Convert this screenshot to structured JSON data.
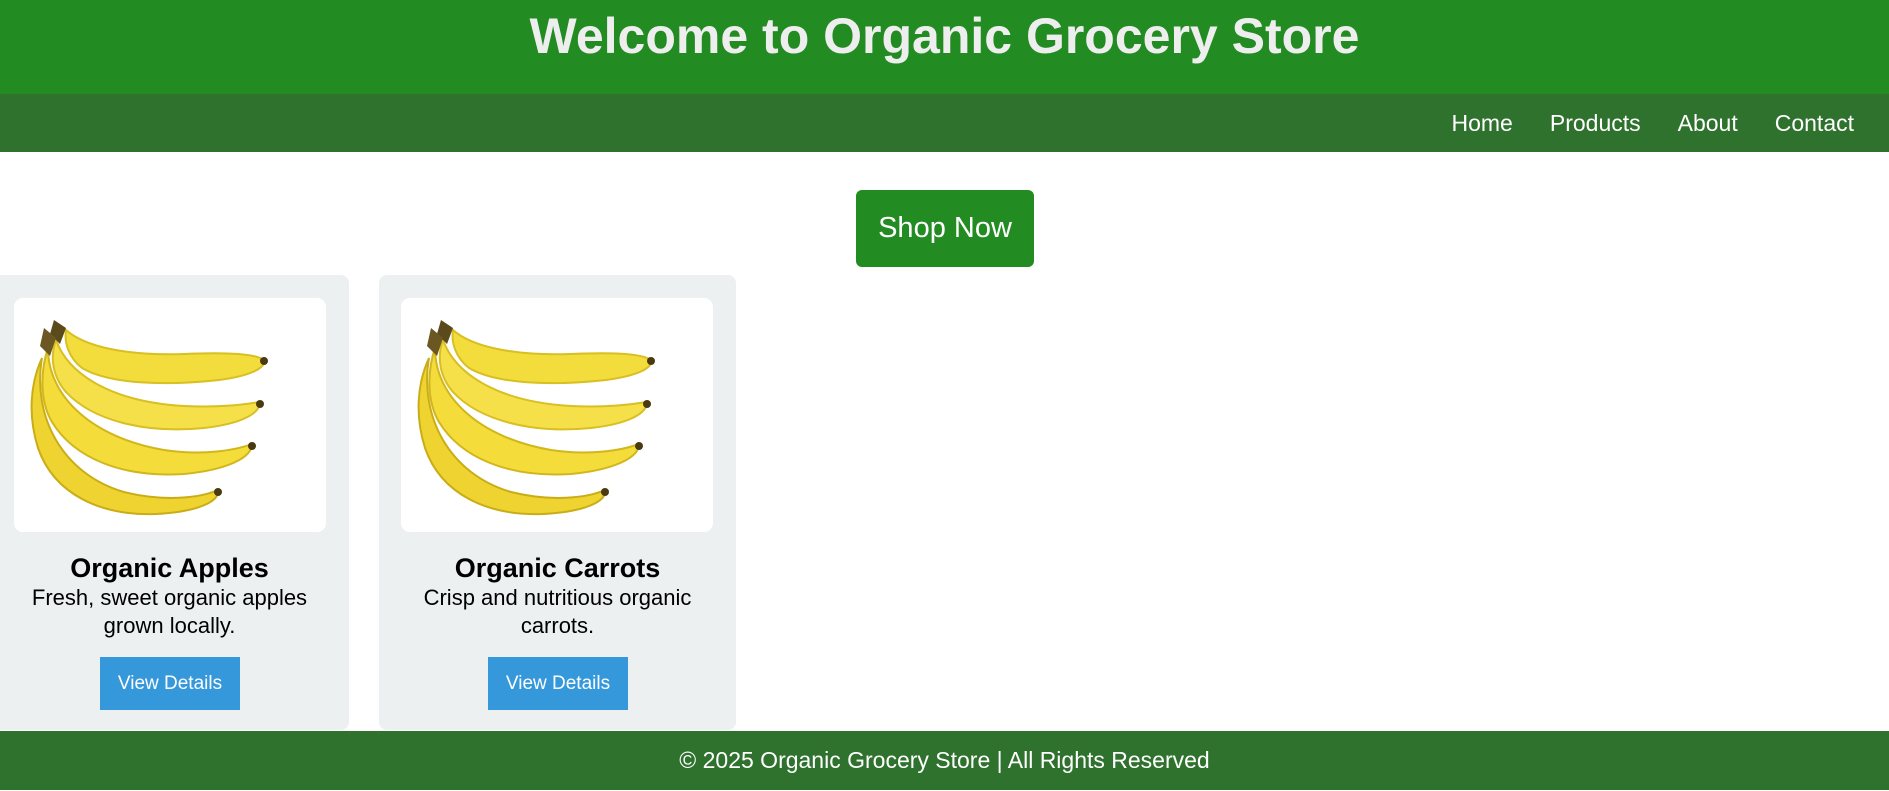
{
  "header": {
    "title": "Welcome to Organic Grocery Store",
    "background": "#228b22"
  },
  "nav": {
    "background": "#2e722e",
    "links": [
      {
        "label": "Home"
      },
      {
        "label": "Products"
      },
      {
        "label": "About"
      },
      {
        "label": "Contact"
      }
    ]
  },
  "hero": {
    "shop_label": "Shop Now"
  },
  "products": [
    {
      "name": "Organic Apples",
      "description": "Fresh, sweet organic apples grown locally.",
      "button_label": "View Details",
      "image": "banana-bunch-image"
    },
    {
      "name": "Organic Carrots",
      "description": "Crisp and nutritious organic carrots.",
      "button_label": "View Details",
      "image": "banana-bunch-image"
    }
  ],
  "footer": {
    "text": "© 2025 Organic Grocery Store | All Rights Reserved"
  },
  "colors": {
    "brand_green": "#228b22",
    "dark_green": "#2e722e",
    "button_blue": "#3498db",
    "card_bg": "#ecf0f1"
  }
}
